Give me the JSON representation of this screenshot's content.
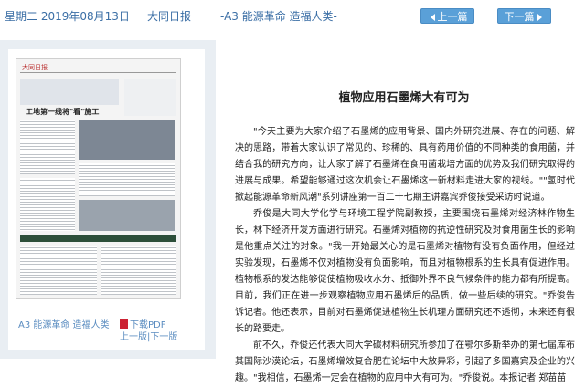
{
  "header": {
    "date": "星期二 2019年08月13日",
    "paper": "大同日报",
    "page": "-A3 能源革命 造福人类-",
    "prev_label": "上一篇",
    "next_label": "下一篇"
  },
  "thumbnail": {
    "masthead": "大同日报",
    "headline": "工地第一线将\"看\"施工",
    "caption": "A3 能源革命 造福人类",
    "pdf_label": "下载PDF",
    "prev_page": "上一版",
    "separator": "|",
    "next_page": "下一版"
  },
  "article": {
    "title": "植物应用石墨烯大有可为",
    "paragraphs": [
      "\"今天主要为大家介绍了石墨烯的应用背景、国内外研究进展、存在的问题、解决的思路，带着大家认识了常见的、珍稀的、具有药用价值的不同种类的食用菌，并结合我的研究方向，让大家了解了石墨烯在食用菌栽培方面的优势及我们研究取得的进展与成果。希望能够通过这次机会让石墨烯这一新材料走进大家的视线。\"\"氢时代掀起能源革命新风潮\"系列讲座第一百二十七期主讲嘉宾乔俊接受采访时说道。",
      "乔俊是大同大学化学与环境工程学院副教授，主要围绕石墨烯对经济林作物生长，林下经济开发方面进行研究。石墨烯对植物的抗逆性研究及对食用菌生长的影响是他重点关注的对象。\"我一开始最关心的是石墨烯对植物有没有负面作用，但经过实验发现，石墨烯不仅对植物没有负面影响，而且对植物根系的生长具有促进作用。植物根系的发达能够促使植物吸收水分、抵御外界不良气候条件的能力都有所提高。目前，我们正在进一步观察植物应用石墨烯后的品质，做一些后续的研究。\"乔俊告诉记者。他还表示，目前对石墨烯促进植物生长机理方面研究还不透彻，未来还有很长的路要走。",
      "前不久，乔俊还代表大同大学碳材料研究所参加了在鄂尔多斯举办的第七届库布其国际沙漠论坛，石墨烯增效复合肥在论坛中大放异彩，引起了多国嘉宾及企业的兴趣。\"我相信，石墨烯一定会在植物的应用中大有可为。\"乔俊说。本报记者 郑苗苗"
    ]
  },
  "colors": {
    "link": "#3a6ea5",
    "button": "#5aa0d8",
    "panel": "#e9eef3"
  }
}
